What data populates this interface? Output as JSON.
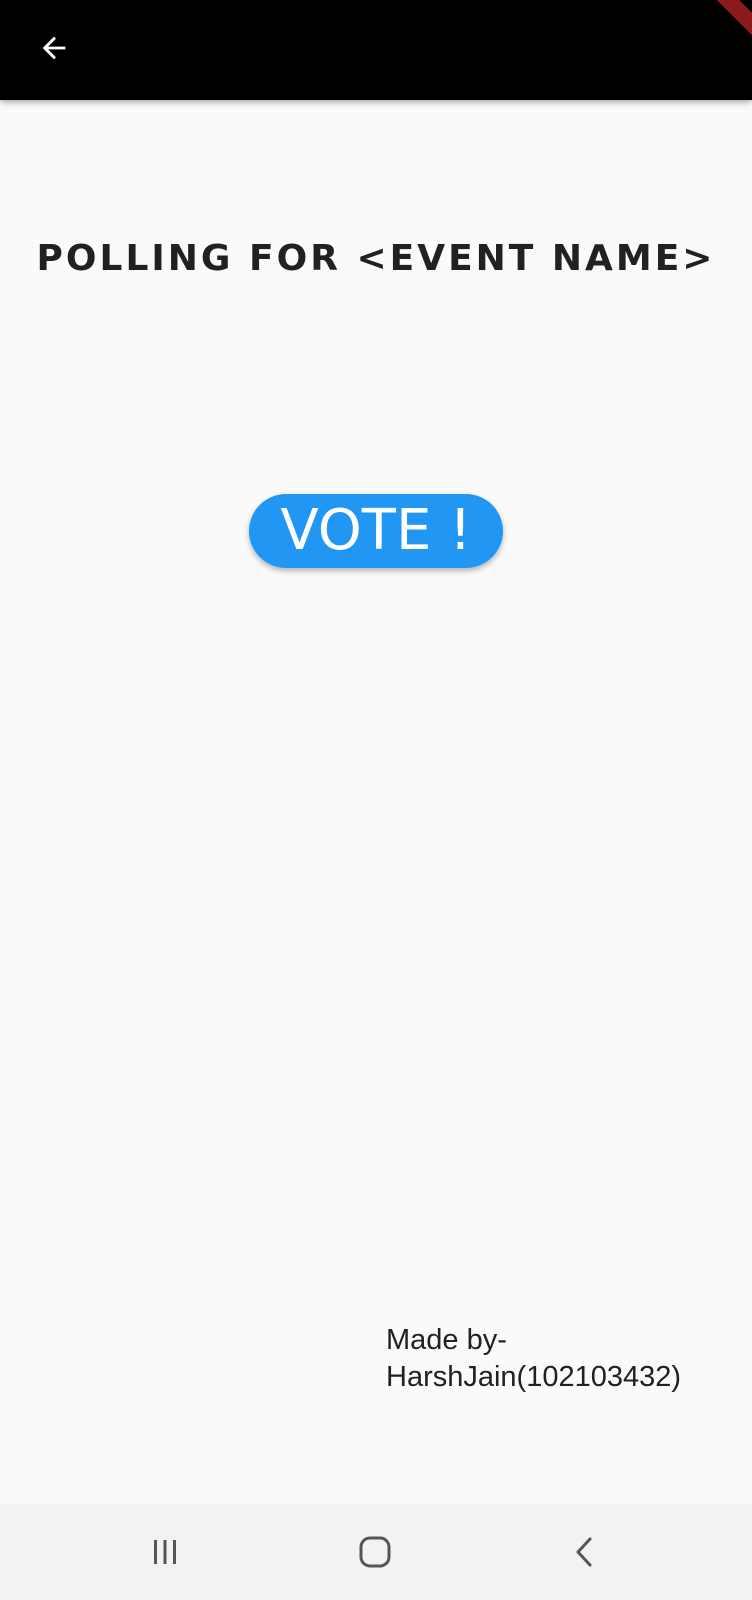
{
  "header": {
    "back_icon": "arrow-left-icon"
  },
  "main": {
    "title": "POLLING FOR <EVENT NAME>",
    "vote_label": "VOTE !"
  },
  "footer": {
    "credit_line1": "Made by-",
    "credit_line2": "HarshJain(102103432)"
  },
  "system_nav": {
    "recents_icon": "recents-icon",
    "home_icon": "home-icon",
    "back_icon": "chevron-left-icon"
  },
  "colors": {
    "app_bar": "#000000",
    "accent": "#2196f3",
    "background": "#fafafa",
    "text": "#212121",
    "debug_banner": "#8b1a1a"
  }
}
